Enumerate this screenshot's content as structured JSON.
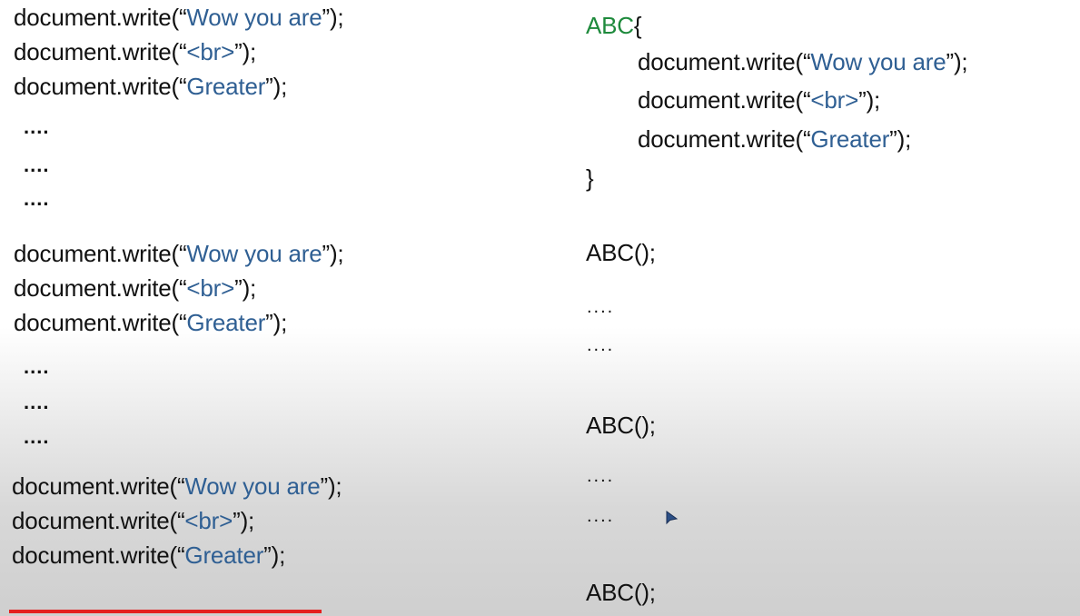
{
  "left": {
    "block1": [
      {
        "pre": "document.write(“",
        "str": "Wow you are",
        "post": "”);"
      },
      {
        "pre": "document.write(“",
        "str": "<br>",
        "post": "”);"
      },
      {
        "pre": "document.write(“",
        "str": "Greater",
        "post": "”);"
      }
    ],
    "dots1": [
      "....",
      "....",
      "...."
    ],
    "block2": [
      {
        "pre": "document.write(“",
        "str": "Wow you are",
        "post": "”);"
      },
      {
        "pre": "document.write(“",
        "str": "<br>",
        "post": "”);"
      },
      {
        "pre": "document.write(“",
        "str": "Greater",
        "post": "”);"
      }
    ],
    "dots2": [
      "....",
      "....",
      "...."
    ],
    "block3": [
      {
        "pre": "document.write(“",
        "str": "Wow you are",
        "post": "”);"
      },
      {
        "pre": "document.write(“",
        "str": "<br>",
        "post": "”);"
      },
      {
        "pre": "document.write(“",
        "str": "Greater",
        "post": "”);"
      }
    ]
  },
  "right": {
    "fn_name": "ABC",
    "open_brace": "{",
    "body": [
      {
        "pre": "document.write(“",
        "str": "Wow you are",
        "post": "”);"
      },
      {
        "pre": "document.write(“",
        "str": "<br>",
        "post": "”);"
      },
      {
        "pre": "document.write(“",
        "str": "Greater",
        "post": "”);"
      }
    ],
    "close_brace": "}",
    "call1": "ABC();",
    "dots1": [
      "....",
      "...."
    ],
    "call2": "ABC();",
    "dots2": [
      "....",
      "...."
    ],
    "call3": "ABC();"
  },
  "colors": {
    "string": "#2f5f93",
    "function_name": "#1e8a3c",
    "progress": "#e41f1f"
  },
  "cursor_icon": "mouse-pointer-icon",
  "progress_fraction": 0.29
}
